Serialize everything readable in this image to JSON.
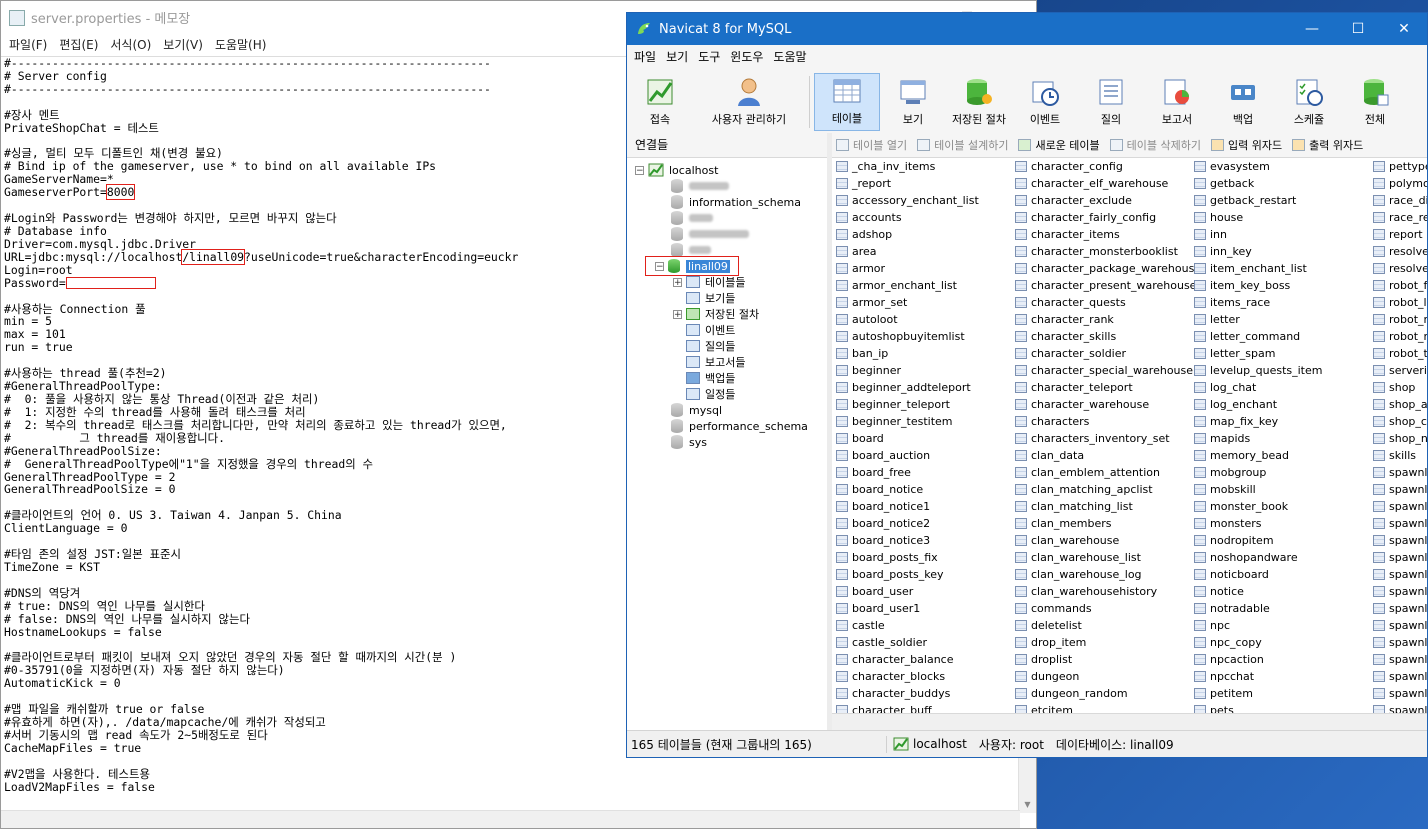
{
  "notepad": {
    "title": "server.properties - 메모장",
    "menu": [
      "파일(F)",
      "편집(E)",
      "서식(O)",
      "보기(V)",
      "도움말(H)"
    ],
    "lines": [
      "#----------------------------------------------------------------------",
      "# Server config",
      "#----------------------------------------------------------------------",
      "",
      "#장사 멘트",
      "PrivateShopChat = 테스트",
      "",
      "#싱글, 멀티 모두 디폴트인 채(변경 불요)",
      "# Bind ip of the gameserver, use * to bind on all available IPs",
      "GameServerName=*",
      "GameserverPort=@@PORT@@",
      "",
      "#Login와 Password는 변경해야 하지만, 모르면 바꾸지 않는다",
      "# Database info",
      "Driver=com.mysql.jdbc.Driver",
      "URL=jdbc:mysql://localhost@@DB@@?useUnicode=true&characterEncoding=euckr",
      "Login=root",
      "Password=@@PASS@@",
      "",
      "#사용하는 Connection 풀",
      "min = 5",
      "max = 101",
      "run = true",
      "",
      "#사용하는 thread 풀(추천=2)",
      "#GeneralThreadPoolType:",
      "#  0: 풀을 사용하지 않는 통상 Thread(이전과 같은 처리)",
      "#  1: 지정한 수의 thread를 사용해 돌려 태스크를 처리",
      "#  2: 복수의 thread로 태스크를 처리합니다만, 만약 처리의 종료하고 있는 thread가 있으면,",
      "#          그 thread를 재이용합니다.",
      "#GeneralThreadPoolSize:",
      "#  GeneralThreadPoolType에\"1\"을 지정했을 경우의 thread의 수",
      "GeneralThreadPoolType = 2",
      "GeneralThreadPoolSize = 0",
      "",
      "#클라이언트의 언어 0. US 3. Taiwan 4. Janpan 5. China",
      "ClientLanguage = 0",
      "",
      "#타임 존의 설정 JST:일본 표준시",
      "TimeZone = KST",
      "",
      "#DNS의 역당겨",
      "# true: DNS의 역인 나무를 실시한다",
      "# false: DNS의 역인 나무를 실시하지 않는다",
      "HostnameLookups = false",
      "",
      "#클라이언트로부터 패킷이 보내져 오지 않았던 경우의 자동 절단 할 때까지의 시간(분 )",
      "#0-35791(0을 지정하면(자) 자동 절단 하지 않는다)",
      "AutomaticKick = 0",
      "",
      "#맵 파일을 캐쉬할까 true or false",
      "#유효하게 하면(자),. /data/mapcache/에 캐쉬가 작성되고",
      "#서버 기동시의 맵 read 속도가 2~5배정도로 된다",
      "CacheMapFiles = true",
      "",
      "#V2맵을 사용한다. 테스트용",
      "LoadV2MapFiles = false"
    ],
    "port_value": "8000",
    "db_value": "/linall09"
  },
  "navicat": {
    "title": "Navicat 8 for MySQL",
    "menu": [
      "파일",
      "보기",
      "도구",
      "윈도우",
      "도움말"
    ],
    "toolbar": [
      {
        "label": "접속",
        "icon": "connect-icon"
      },
      {
        "label": "사용자 관리하기",
        "icon": "user-manager-icon"
      },
      {
        "label": "테이블",
        "icon": "table-icon"
      },
      {
        "label": "보기",
        "icon": "view-icon"
      },
      {
        "label": "저장된 절차",
        "icon": "stored-procedure-icon"
      },
      {
        "label": "이벤트",
        "icon": "event-icon"
      },
      {
        "label": "질의",
        "icon": "query-icon"
      },
      {
        "label": "보고서",
        "icon": "report-icon"
      },
      {
        "label": "백업",
        "icon": "backup-icon"
      },
      {
        "label": "스케쥴",
        "icon": "schedule-icon"
      },
      {
        "label": "전체",
        "icon": "all-icon"
      }
    ],
    "connections_header": "연결들",
    "tree": {
      "host": "localhost",
      "db_info": "information_schema",
      "selected_db": "linall09",
      "children": [
        "테이블들",
        "보기들",
        "저장된 절차",
        "이벤트",
        "질의들",
        "보고서들",
        "백업들",
        "일정들"
      ],
      "dbs_after": [
        "mysql",
        "performance_schema",
        "sys"
      ]
    },
    "object_toolbar": [
      "테이블 열기",
      "테이블 설계하기",
      "새로운 테이블",
      "테이블 삭제하기",
      "입력 위자드",
      "출력 위자드"
    ],
    "tables_col1": [
      "_cha_inv_items",
      "_report",
      "accessory_enchant_list",
      "accounts",
      "adshop",
      "area",
      "armor",
      "armor_enchant_list",
      "armor_set",
      "autoloot",
      "autoshopbuyitemlist",
      "ban_ip",
      "beginner",
      "beginner_addteleport",
      "beginner_teleport",
      "beginner_testitem",
      "board",
      "board_auction",
      "board_free",
      "board_notice",
      "board_notice1",
      "board_notice2",
      "board_notice3",
      "board_posts_fix",
      "board_posts_key",
      "board_user",
      "board_user1",
      "castle",
      "castle_soldier",
      "character_balance",
      "character_blocks",
      "character_buddys",
      "character_buff"
    ],
    "tables_col2": [
      "character_config",
      "character_elf_warehouse",
      "character_exclude",
      "character_fairly_config",
      "character_items",
      "character_monsterbooklist",
      "character_package_warehouse",
      "character_present_warehouse",
      "character_quests",
      "character_rank",
      "character_skills",
      "character_soldier",
      "character_special_warehouse",
      "character_teleport",
      "character_warehouse",
      "characters",
      "characters_inventory_set",
      "clan_data",
      "clan_emblem_attention",
      "clan_matching_apclist",
      "clan_matching_list",
      "clan_members",
      "clan_warehouse",
      "clan_warehouse_list",
      "clan_warehouse_log",
      "clan_warehousehistory",
      "commands",
      "deletelist",
      "drop_item",
      "droplist",
      "dungeon",
      "dungeon_random",
      "etcitem"
    ],
    "tables_col3": [
      "evasystem",
      "getback",
      "getback_restart",
      "house",
      "inn",
      "inn_key",
      "item_enchant_list",
      "item_key_boss",
      "items_race",
      "letter",
      "letter_command",
      "letter_spam",
      "levelup_quests_item",
      "log_chat",
      "log_enchant",
      "map_fix_key",
      "mapids",
      "memory_bead",
      "mobgroup",
      "mobskill",
      "monster_book",
      "monsters",
      "nodropitem",
      "noshopandware",
      "noticboard",
      "notice",
      "notradable",
      "npc",
      "npc_copy",
      "npcaction",
      "npcchat",
      "petitem",
      "pets"
    ],
    "tables_col4": [
      "pettype",
      "polymor",
      "race_div",
      "race_re",
      "report",
      "resolver",
      "resolver",
      "robot_fi",
      "robot_lo",
      "robot_m",
      "robot_n",
      "robot_te",
      "serverin",
      "shop",
      "shop_ad",
      "shop_co",
      "shop_np",
      "skills",
      "spawnlis",
      "spawnlis",
      "spawnlis",
      "spawnlis",
      "spawnlis",
      "spawnlis",
      "spawnlis",
      "spawnlis",
      "spawnlis",
      "spawnlis",
      "spawnlis",
      "spawnlis",
      "spawnlis",
      "spawnlis",
      "spawnlis"
    ],
    "status": {
      "count": "165 테이블들 (현재 그룹내의 165)",
      "host": "localhost",
      "user": "사용자: root",
      "db": "데이타베이스: linall09"
    }
  }
}
